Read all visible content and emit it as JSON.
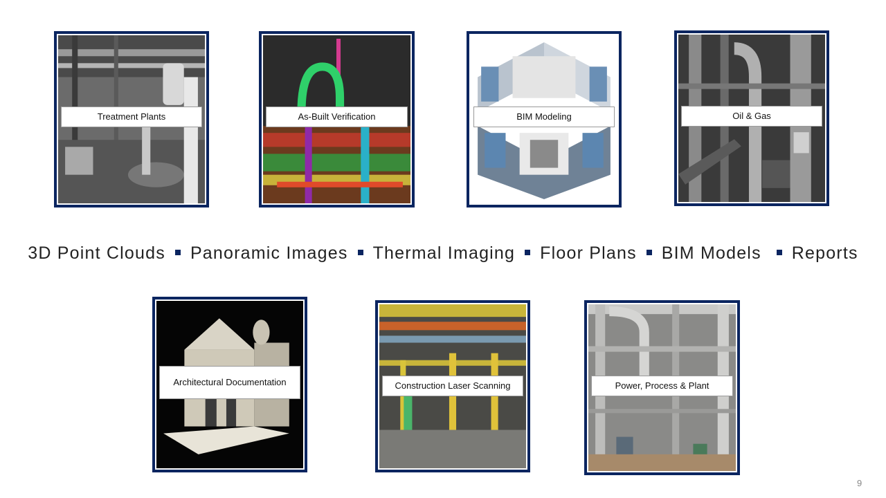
{
  "tiles": [
    {
      "id": "treatment-plants",
      "label": "Treatment Plants",
      "bg": "#6e6e6e"
    },
    {
      "id": "as-built-verification",
      "label": "As-Built Verification",
      "bg": "#2a2a2a"
    },
    {
      "id": "bim-modeling",
      "label": "BIM Modeling",
      "bg": "#9fb3c8"
    },
    {
      "id": "oil-gas",
      "label": "Oil & Gas",
      "bg": "#3a3a3a"
    },
    {
      "id": "architectural-documentation",
      "label": "Architectural Documentation",
      "bg": "#050505"
    },
    {
      "id": "construction-laser-scanning",
      "label": "Construction Laser Scanning",
      "bg": "#5a5a55"
    },
    {
      "id": "power-process-plant",
      "label": "Power, Process & Plant",
      "bg": "#8a8a8a"
    }
  ],
  "services": [
    "3D Point Clouds",
    "Panoramic Images",
    "Thermal Imaging",
    "Floor Plans",
    "BIM Models",
    "Reports"
  ],
  "page_number": "9",
  "colors": {
    "frame": "#0b2560",
    "bullet": "#0b2560",
    "text": "#222222"
  }
}
